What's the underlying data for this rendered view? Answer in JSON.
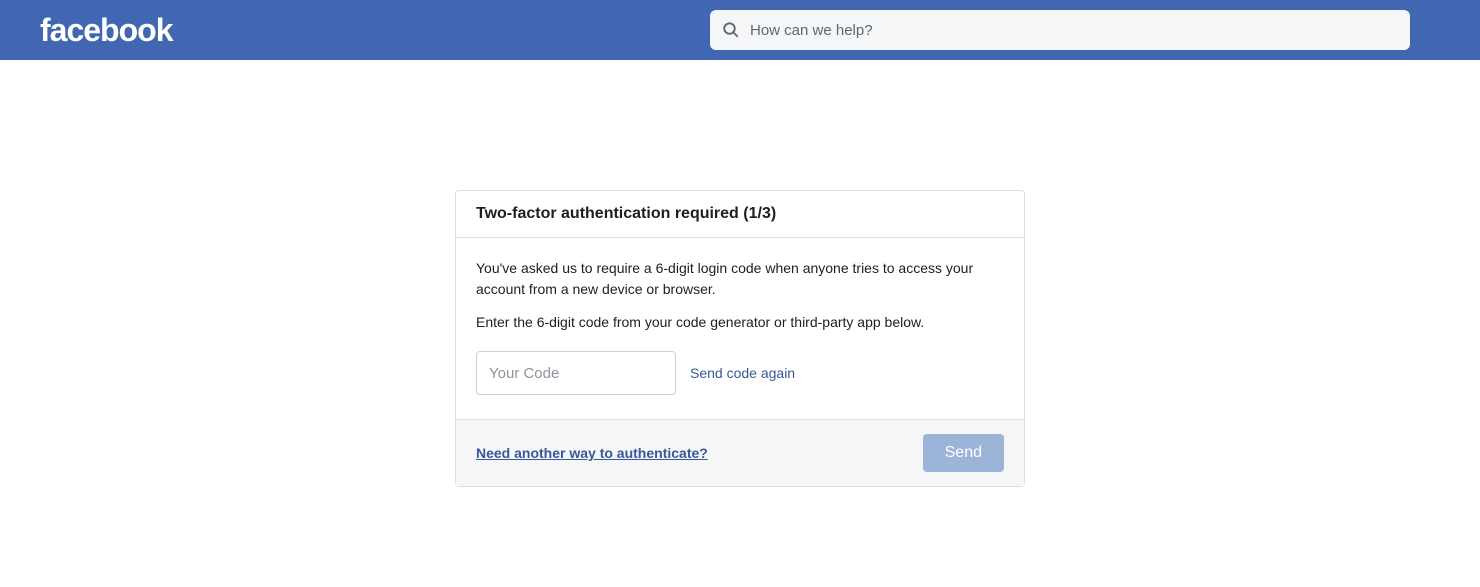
{
  "header": {
    "logo_text": "facebook",
    "search_placeholder": "How can we help?"
  },
  "card": {
    "title": "Two-factor authentication required (1/3)",
    "body_text_1": "You've asked us to require a 6-digit login code when anyone tries to access your account from a new device or browser.",
    "body_text_2": "Enter the 6-digit code from your code generator or third-party app below.",
    "code_placeholder": "Your Code",
    "resend_label": "Send code again",
    "another_way_label": "Need another way to authenticate?",
    "send_label": "Send"
  }
}
